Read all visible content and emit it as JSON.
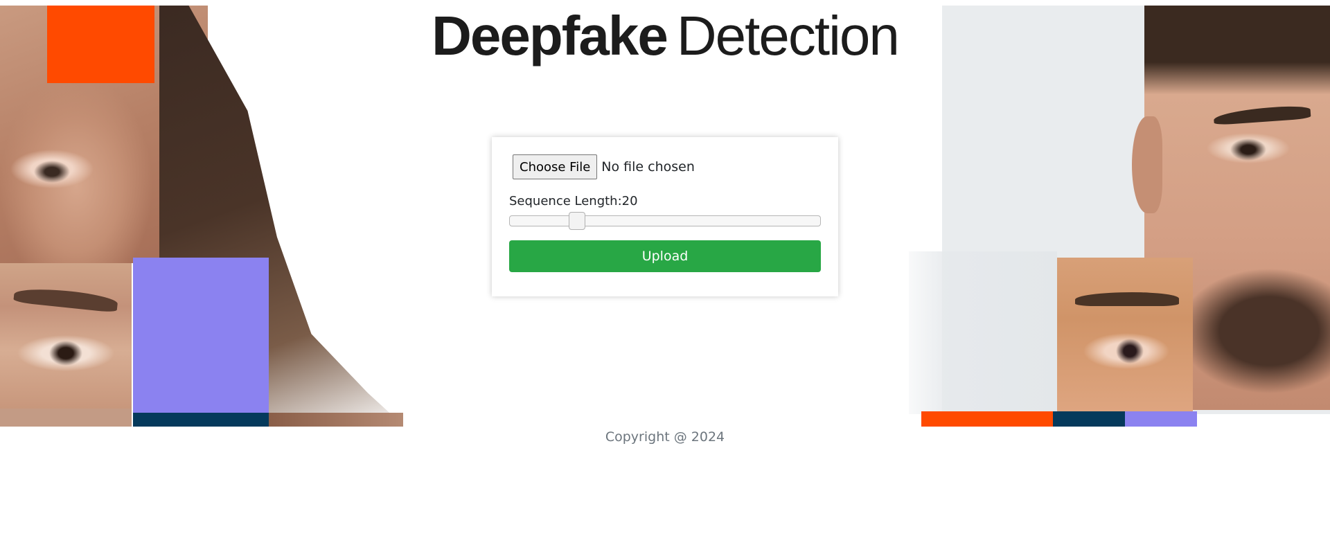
{
  "header": {
    "title_bold": "Deepfake",
    "title_light": "Detection"
  },
  "upload_form": {
    "choose_file_label": "Choose File",
    "file_status": "No file chosen",
    "sequence_length_label": "Sequence Length:",
    "sequence_length_value": "20",
    "slider_fraction": 0.2,
    "upload_label": "Upload"
  },
  "footer": {
    "copyright": "Copyright @ 2024"
  },
  "colors": {
    "accent_orange": "#ff4a00",
    "accent_purple": "#8b82f0",
    "accent_navy": "#053a5c",
    "upload_button": "#28a745"
  }
}
